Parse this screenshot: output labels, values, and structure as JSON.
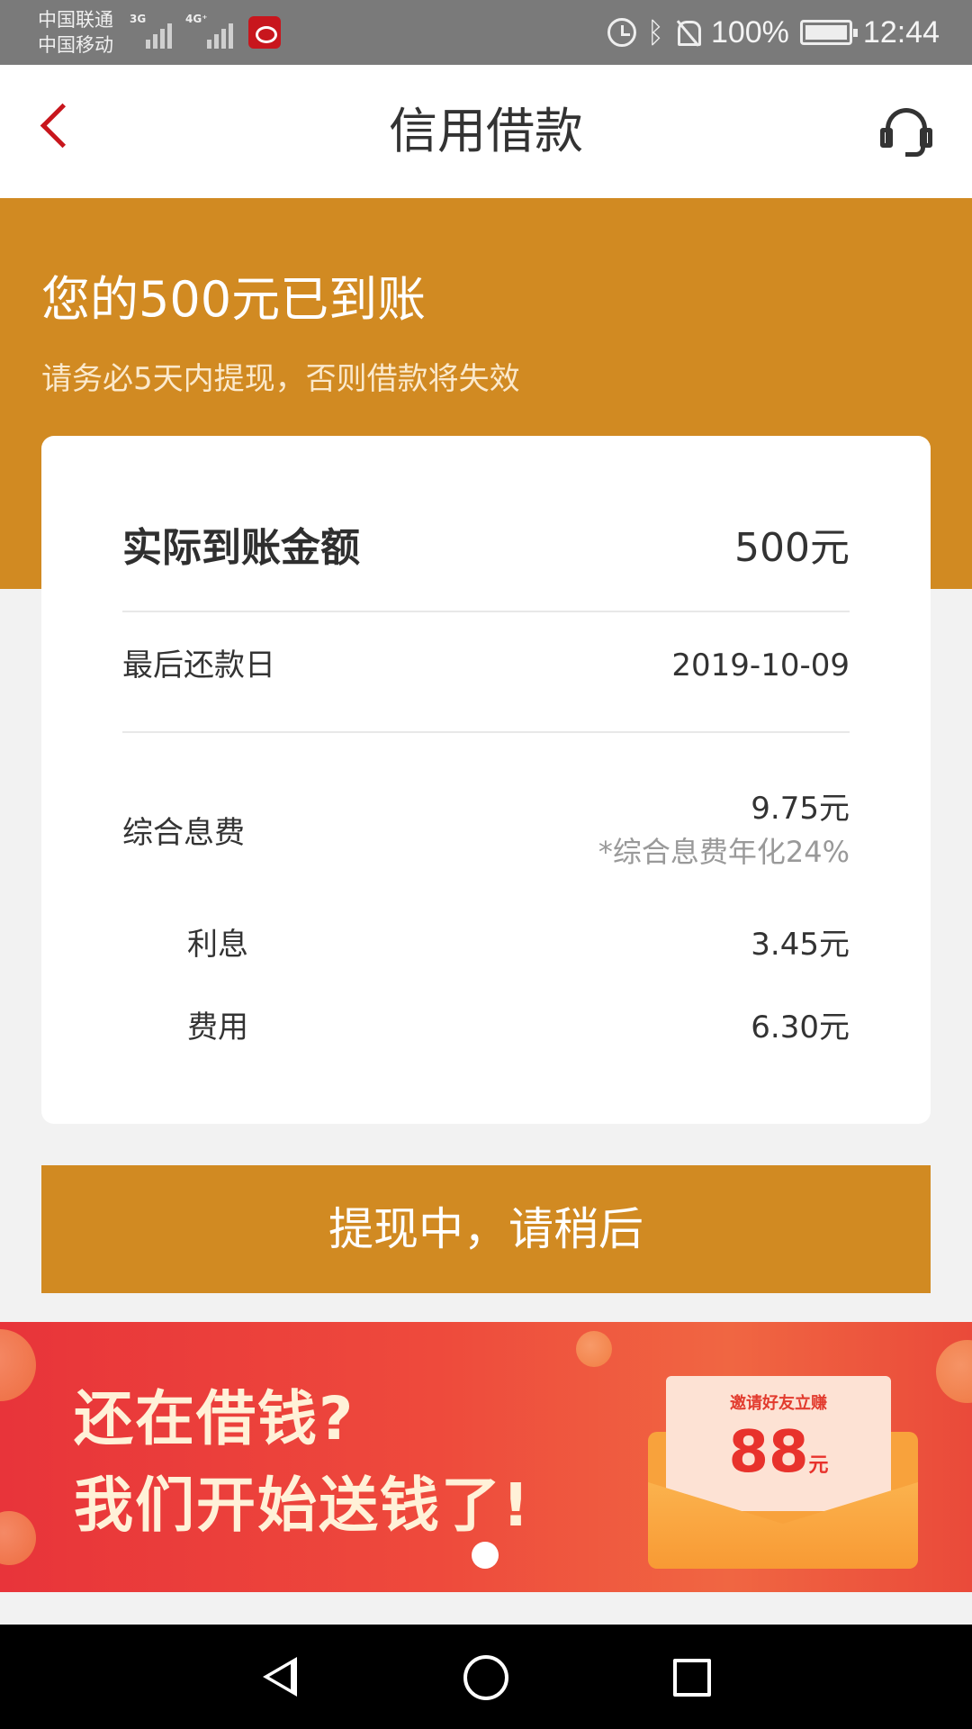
{
  "status_bar": {
    "carrier1": "中国联通",
    "carrier2": "中国移动",
    "net1": "3G",
    "net2": "4G⁺",
    "battery": "100%",
    "time": "12:44"
  },
  "header": {
    "title": "信用借款"
  },
  "banner": {
    "title": "您的500元已到账",
    "subtitle": "请务必5天内提现，否则借款将失效"
  },
  "details": {
    "amount_label": "实际到账金额",
    "amount_value": "500元",
    "due_label": "最后还款日",
    "due_value": "2019-10-09",
    "fee_label": "综合息费",
    "fee_value": "9.75元",
    "fee_note": "*综合息费年化24%",
    "interest_label": "利息",
    "interest_value": "3.45元",
    "cost_label": "费用",
    "cost_value": "6.30元"
  },
  "action": {
    "button_label": "提现中，请稍后"
  },
  "promo": {
    "line1": "还在借钱?",
    "line2": "我们开始送钱了!",
    "invite": "邀请好友立赚",
    "amount": "88",
    "unit": "元"
  },
  "colors": {
    "brand": "#d18a22",
    "accent_red": "#c8161d"
  },
  "icons": {
    "back": "back-chevron-icon",
    "service": "headset-icon"
  }
}
